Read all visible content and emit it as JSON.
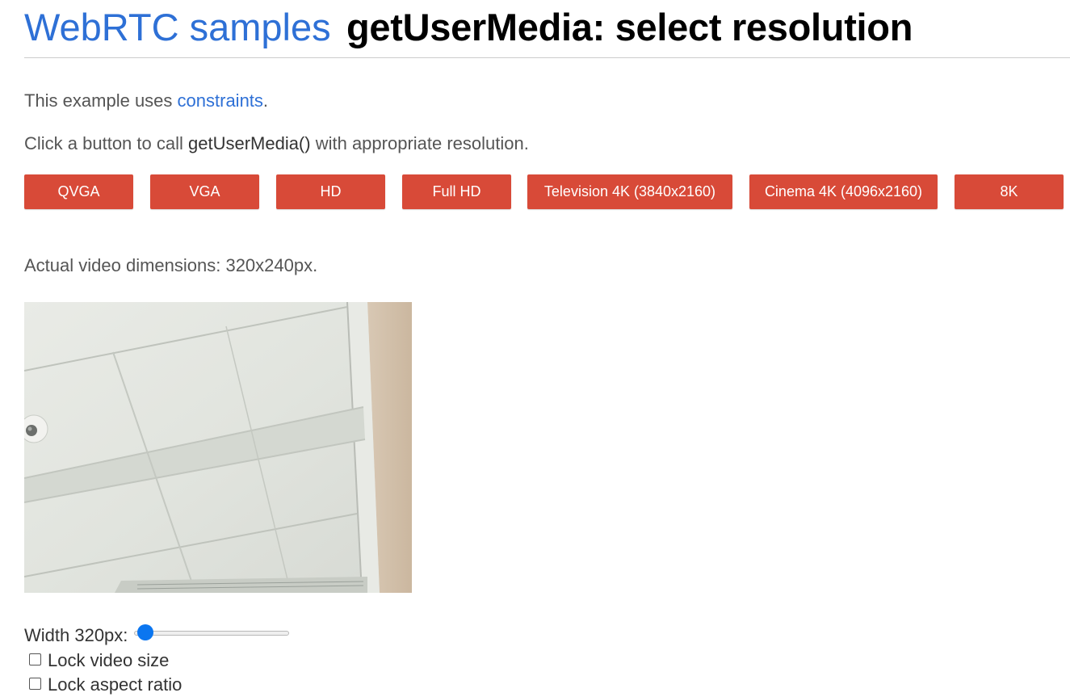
{
  "header": {
    "site_link": "WebRTC samples",
    "page_title": "getUserMedia: select resolution"
  },
  "intro": {
    "prefix": "This example uses ",
    "link": "constraints",
    "suffix": "."
  },
  "instructions": {
    "prefix": "Click a button to call ",
    "code": "getUserMedia()",
    "suffix": " with appropriate resolution."
  },
  "buttons": {
    "qvga": "QVGA",
    "vga": "VGA",
    "hd": "HD",
    "full_hd": "Full HD",
    "tv4k": "Television 4K (3840x2160)",
    "cinema4k": "Cinema 4K (4096x2160)",
    "k8": "8K"
  },
  "dimensions_text": "Actual video dimensions: 320x240px.",
  "controls": {
    "width_label": "Width 320px:",
    "width_slider_fraction": 0.0,
    "lock_video_size": "Lock video size",
    "lock_aspect_ratio": "Lock aspect ratio"
  },
  "colors": {
    "link": "#2e70d6",
    "button": "#d84a38",
    "slider_thumb": "#0b76f0"
  }
}
